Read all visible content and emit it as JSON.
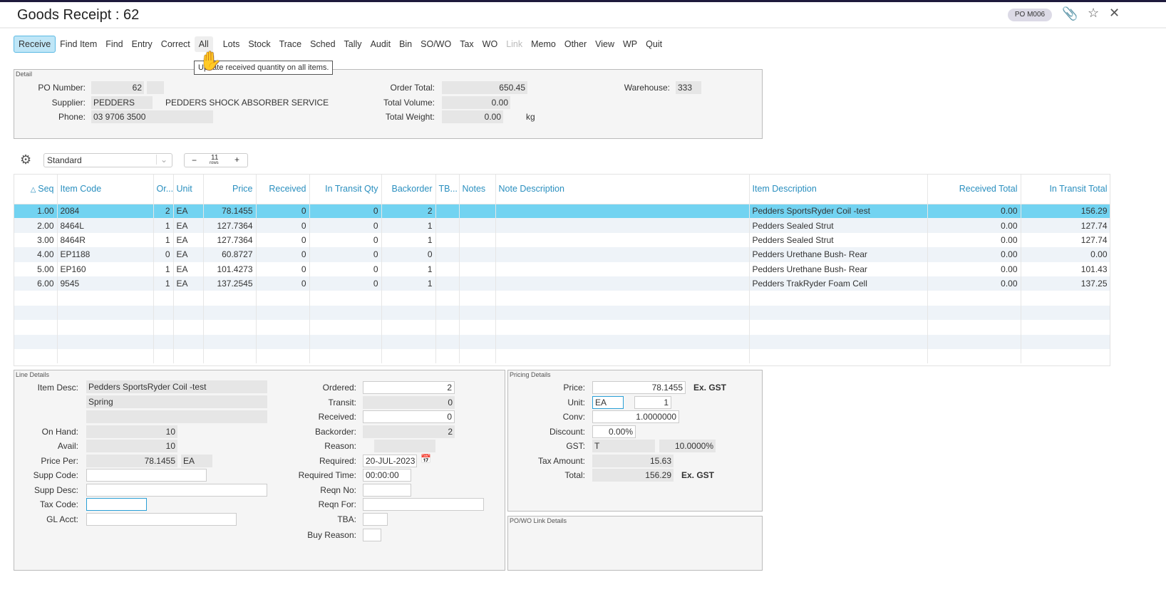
{
  "window": {
    "title": "Goods Receipt : 62",
    "badge": "PO M006"
  },
  "toolbar": [
    "Receive",
    "Find Item",
    "Find",
    "Entry",
    "Correct",
    "All",
    "Lots",
    "Stock",
    "Trace",
    "Sched",
    "Tally",
    "Audit",
    "Bin",
    "SO/WO",
    "Tax",
    "WO",
    "Link",
    "Memo",
    "Other",
    "View",
    "WP",
    "Quit"
  ],
  "tooltip": "Update received quantity on all items.",
  "detail": {
    "title": "Detail",
    "po_number_label": "PO Number:",
    "po_number": "62",
    "supplier_label": "Supplier:",
    "supplier_code": "PEDDERS",
    "supplier_name": "PEDDERS SHOCK ABSORBER SERVICE",
    "phone_label": "Phone:",
    "phone": "03 9706 3500",
    "order_total_label": "Order Total:",
    "order_total": "650.45",
    "total_volume_label": "Total Volume:",
    "total_volume": "0.00",
    "total_weight_label": "Total Weight:",
    "total_weight": "0.00",
    "weight_unit": "kg",
    "warehouse_label": "Warehouse:",
    "warehouse": "333"
  },
  "grid_toolbar": {
    "view": "Standard",
    "rows": "11",
    "rows_label": "rows"
  },
  "table": {
    "columns": [
      "Seq",
      "Item Code",
      "Or...",
      "Unit",
      "Price",
      "Received",
      "In Transit Qty",
      "Backorder",
      "TB...",
      "Notes",
      "Note Description",
      "Item Description",
      "Received Total",
      "In Transit Total"
    ],
    "rows": [
      [
        "1.00",
        "2084",
        "2",
        "EA",
        "78.1455",
        "0",
        "0",
        "2",
        "",
        "",
        "",
        "Pedders SportsRyder Coil -test",
        "0.00",
        "156.29"
      ],
      [
        "2.00",
        "8464L",
        "1",
        "EA",
        "127.7364",
        "0",
        "0",
        "1",
        "",
        "",
        "",
        "Pedders Sealed Strut",
        "0.00",
        "127.74"
      ],
      [
        "3.00",
        "8464R",
        "1",
        "EA",
        "127.7364",
        "0",
        "0",
        "1",
        "",
        "",
        "",
        "Pedders Sealed Strut",
        "0.00",
        "127.74"
      ],
      [
        "4.00",
        "EP1188",
        "0",
        "EA",
        "60.8727",
        "0",
        "0",
        "0",
        "",
        "",
        "",
        "Pedders Urethane Bush- Rear",
        "0.00",
        "0.00"
      ],
      [
        "5.00",
        "EP160",
        "1",
        "EA",
        "101.4273",
        "0",
        "0",
        "1",
        "",
        "",
        "",
        "Pedders Urethane Bush- Rear",
        "0.00",
        "101.43"
      ],
      [
        "6.00",
        "9545",
        "1",
        "EA",
        "137.2545",
        "0",
        "0",
        "1",
        "",
        "",
        "",
        "Pedders TrakRyder Foam Cell",
        "0.00",
        "137.25"
      ]
    ]
  },
  "line": {
    "title": "Line Details",
    "item_desc_label": "Item Desc:",
    "item_desc1": "Pedders SportsRyder Coil -test",
    "item_desc2": "Spring",
    "on_hand_label": "On Hand:",
    "on_hand": "10",
    "avail_label": "Avail:",
    "avail": "10",
    "price_per_label": "Price Per:",
    "price_per": "78.1455",
    "price_per_unit": "EA",
    "supp_code_label": "Supp Code:",
    "supp_desc_label": "Supp Desc:",
    "tax_code_label": "Tax Code:",
    "gl_acct_label": "GL Acct:",
    "ordered_label": "Ordered:",
    "ordered": "2",
    "transit_label": "Transit:",
    "transit": "0",
    "received_label": "Received:",
    "received": "0",
    "backorder_label": "Backorder:",
    "backorder": "2",
    "reason_label": "Reason:",
    "required_label": "Required:",
    "required": "20-JUL-2023",
    "required_time_label": "Required Time:",
    "required_time": "00:00:00",
    "reqn_no_label": "Reqn No:",
    "reqn_for_label": "Reqn For:",
    "tba_label": "TBA:",
    "buy_reason_label": "Buy Reason:"
  },
  "pricing": {
    "title": "Pricing Details",
    "price_label": "Price:",
    "price": "78.1455",
    "ex_gst": "Ex. GST",
    "unit_label": "Unit:",
    "unit": "EA",
    "unit_qty": "1",
    "conv_label": "Conv:",
    "conv": "1.0000000",
    "discount_label": "Discount:",
    "discount": "0.00%",
    "gst_label": "GST:",
    "gst_code": "T",
    "gst_rate": "10.0000%",
    "tax_amount_label": "Tax Amount:",
    "tax_amount": "15.63",
    "total_label": "Total:",
    "total": "156.29",
    "total_ex_gst": "Ex. GST"
  },
  "link": {
    "title": "PO/WO Link Details"
  },
  "colors": {
    "selected_row": "#72d3f1",
    "accent": "#2a8fbf"
  }
}
